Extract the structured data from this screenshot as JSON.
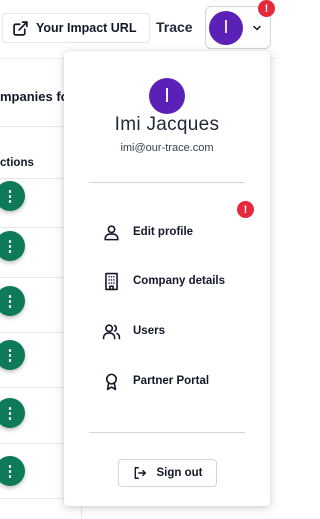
{
  "header": {
    "impact_url_label": "Your Impact URL",
    "org_name": "Trace",
    "avatar_initial": "I",
    "notification_badge": "!"
  },
  "page": {
    "companies_label": "mpanies fo",
    "actions_label": "ctions",
    "row_action_glyph": "⋮"
  },
  "user_menu": {
    "avatar_initial": "I",
    "name": "Imi Jacques",
    "email": "imi@our-trace.com",
    "alert_badge": "!",
    "items": [
      {
        "label": "Edit profile",
        "icon": "user-icon"
      },
      {
        "label": "Company details",
        "icon": "building-icon"
      },
      {
        "label": "Users",
        "icon": "users-icon"
      },
      {
        "label": "Partner Portal",
        "icon": "award-icon"
      }
    ],
    "sign_out_label": "Sign out"
  },
  "colors": {
    "avatar": "#5b21b6",
    "alert": "#e5293b",
    "action_button": "#0f7a5a"
  }
}
